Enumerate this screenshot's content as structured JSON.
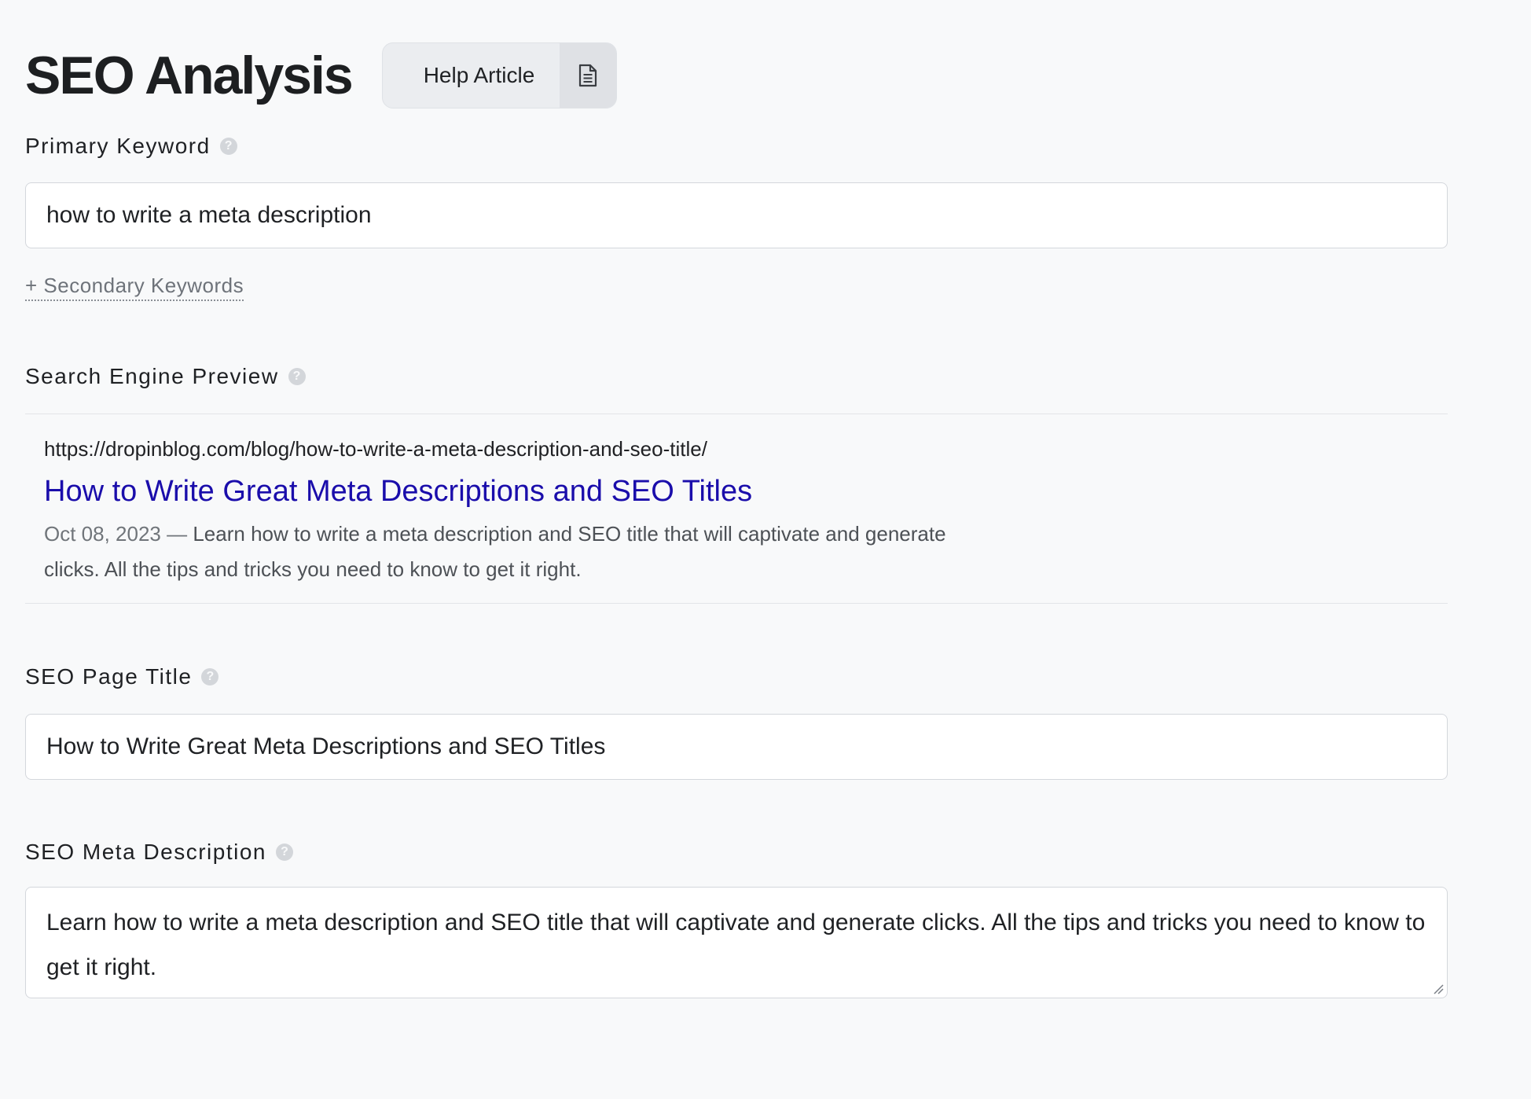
{
  "header": {
    "title": "SEO Analysis",
    "help_button_label": "Help Article",
    "help_icon": "document-icon"
  },
  "primary_keyword": {
    "label": "Primary Keyword",
    "value": "how to write a meta description",
    "help_icon": "question-circle-icon"
  },
  "secondary_keywords": {
    "link_label": "+ Secondary Keywords"
  },
  "search_preview": {
    "label": "Search Engine Preview",
    "url": "https://dropinblog.com/blog/how-to-write-a-meta-description-and-seo-title/",
    "title": "How to Write Great Meta Descriptions and SEO Titles",
    "date": "Oct 08, 2023",
    "separator": " — ",
    "description": "Learn how to write a meta description and SEO title that will captivate and generate clicks. All the tips and tricks you need to know to get it right.",
    "title_color": "#1a0dab"
  },
  "seo_page_title": {
    "label": "SEO Page Title",
    "value": "How to Write Great Meta Descriptions and SEO Titles"
  },
  "seo_meta_description": {
    "label": "SEO Meta Description",
    "value": "Learn how to write a meta description and SEO title that will captivate and generate clicks. All the tips and tricks you need to know to get it right."
  }
}
